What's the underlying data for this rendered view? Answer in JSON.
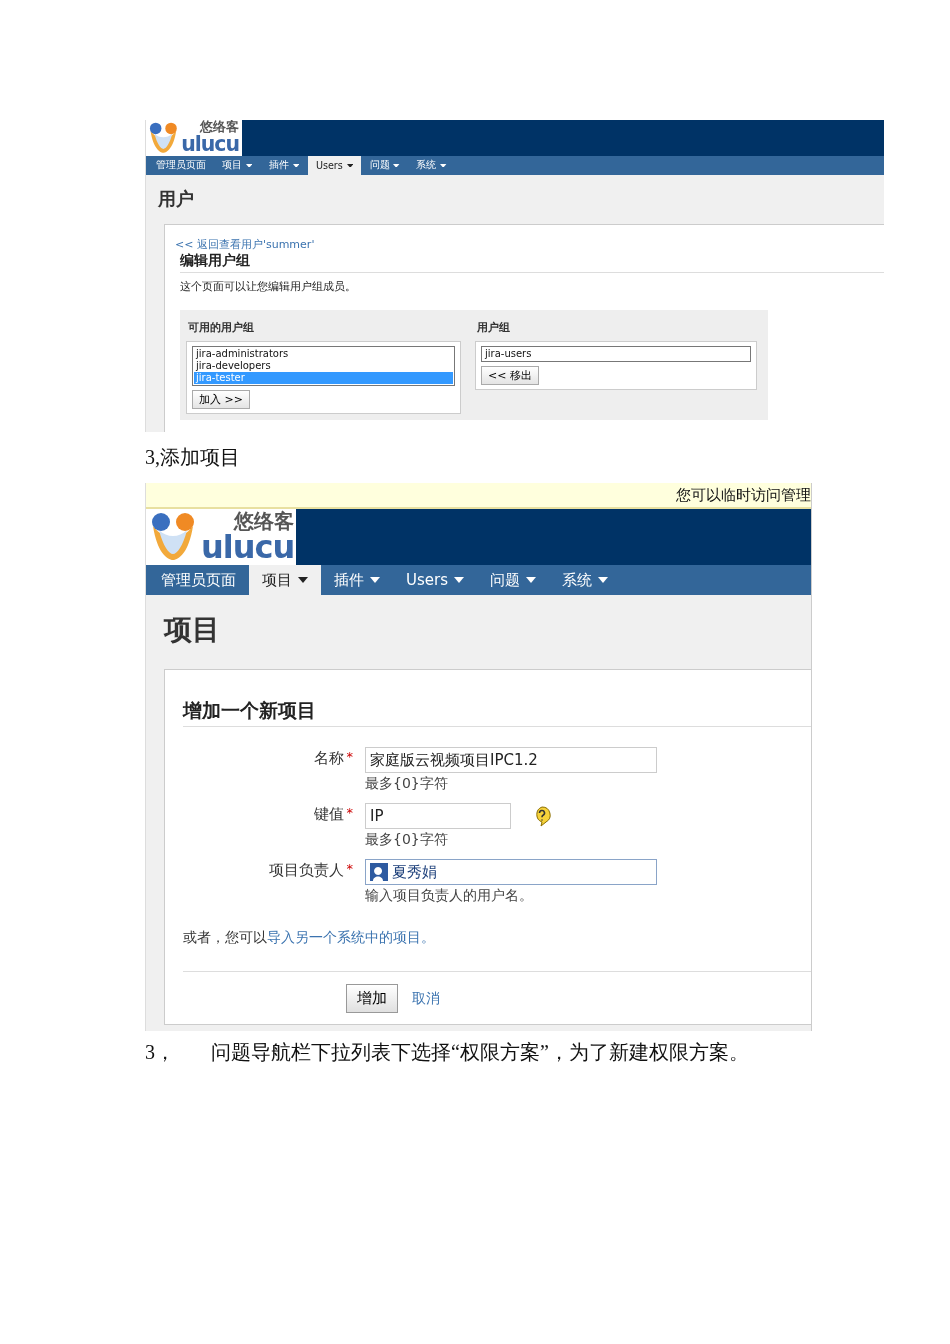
{
  "edit_groups_screenshot": {
    "logo": {
      "cn": "悠络客",
      "en": "ulucu"
    },
    "nav": [
      {
        "label": "管理员页面",
        "dropdown": false,
        "selected": false
      },
      {
        "label": "项目",
        "dropdown": true,
        "selected": false
      },
      {
        "label": "插件",
        "dropdown": true,
        "selected": false
      },
      {
        "label": "Users",
        "dropdown": true,
        "selected": true
      },
      {
        "label": "问题",
        "dropdown": true,
        "selected": false
      },
      {
        "label": "系统",
        "dropdown": true,
        "selected": false
      }
    ],
    "page_title": "用户",
    "back_link": "<< 返回查看用户'summer'",
    "heading": "编辑用户组",
    "description": "这个页面可以让您编辑用户组成员。",
    "lists": [
      {
        "title": "可用的用户组",
        "button": "加入 >>",
        "options": [
          {
            "label": "jira-administrators",
            "selected": false
          },
          {
            "label": "jira-developers",
            "selected": false
          },
          {
            "label": "jira-tester",
            "selected": true
          }
        ]
      },
      {
        "title": "用户组",
        "button": "<< 移出",
        "options": [
          {
            "label": "jira-users",
            "selected": false
          }
        ]
      }
    ]
  },
  "caption_1": "3,添加项目",
  "add_project_screenshot": {
    "banner": "您可以临时访问管理",
    "logo": {
      "cn": "悠络客",
      "en": "ulucu"
    },
    "nav": [
      {
        "label": "管理员页面",
        "dropdown": false,
        "selected": false
      },
      {
        "label": "项目",
        "dropdown": true,
        "selected": true
      },
      {
        "label": "插件",
        "dropdown": true,
        "selected": false
      },
      {
        "label": "Users",
        "dropdown": true,
        "selected": false
      },
      {
        "label": "问题",
        "dropdown": true,
        "selected": false
      },
      {
        "label": "系统",
        "dropdown": true,
        "selected": false
      }
    ],
    "page_title": "项目",
    "heading": "增加一个新项目",
    "fields": [
      {
        "kind": "text",
        "label": "名称",
        "required_mark": "*",
        "value": "家庭版云视频项目IPC1.2",
        "hint": "最多{0}字符",
        "help": false
      },
      {
        "kind": "short",
        "label": "键值",
        "required_mark": "*",
        "value": "IP",
        "hint": "最多{0}字符",
        "help": true
      },
      {
        "kind": "user",
        "label": "项目负责人",
        "required_mark": "*",
        "value": "夏秀娟",
        "hint": "输入项目负责人的用户名。",
        "help": false
      }
    ],
    "import_prefix": "或者，您可以",
    "import_link": "导入另一个系统中的项目。",
    "buttons": {
      "submit": "增加",
      "cancel": "取消"
    }
  },
  "caption_2": {
    "number": "3，",
    "text": "问题导航栏下拉列表下选择“权限方案”，为了新建权限方案。"
  }
}
